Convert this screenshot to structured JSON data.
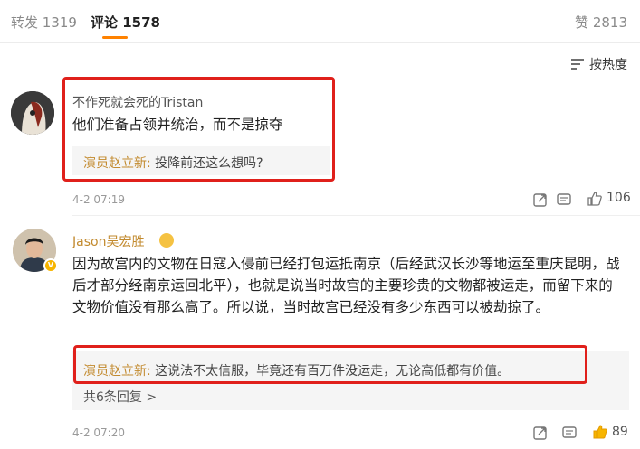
{
  "tabs": {
    "repost_label": "转发 1319",
    "comment_label": "评论 1578",
    "like_label": "赞 2813"
  },
  "sort": {
    "label": "按热度",
    "icon": "sort-lines-icon"
  },
  "comments": [
    {
      "username": "不作死就会死的Tristan",
      "text": "他们准备占领并统治，而不是掠夺",
      "reply_author": "演员赵立新:",
      "reply_text": " 投降前还这么想吗?",
      "time": "4-2 07:19",
      "likes": "106",
      "actions": [
        "share-icon",
        "comment-icon",
        "like-icon"
      ]
    },
    {
      "username": "Jason吴宏胜",
      "text": "因为故宫内的文物在日寇入侵前已经打包运抵南京（后经武汉长沙等地运至重庆昆明，战后才部分经南京运回北平），也就是说当时故宫的主要珍贵的文物都被运走，而留下来的文物价值没有那么高了。所以说，当时故宫已经没有多少东西可以被劫掠了。",
      "reply_author": "演员赵立新:",
      "reply_text": " 这说法不太信服，毕竟还有百万件没运走，无论高低都有价值。",
      "more_replies": "共6条回复 >",
      "time": "4-2 07:20",
      "likes": "89",
      "actions": [
        "share-icon",
        "comment-icon",
        "like-icon"
      ]
    }
  ],
  "colors": {
    "accent": "#ff8200",
    "highlight_box": "#e0201b",
    "reply_bg": "#f5f5f5",
    "vip_name": "#c28a2e"
  }
}
